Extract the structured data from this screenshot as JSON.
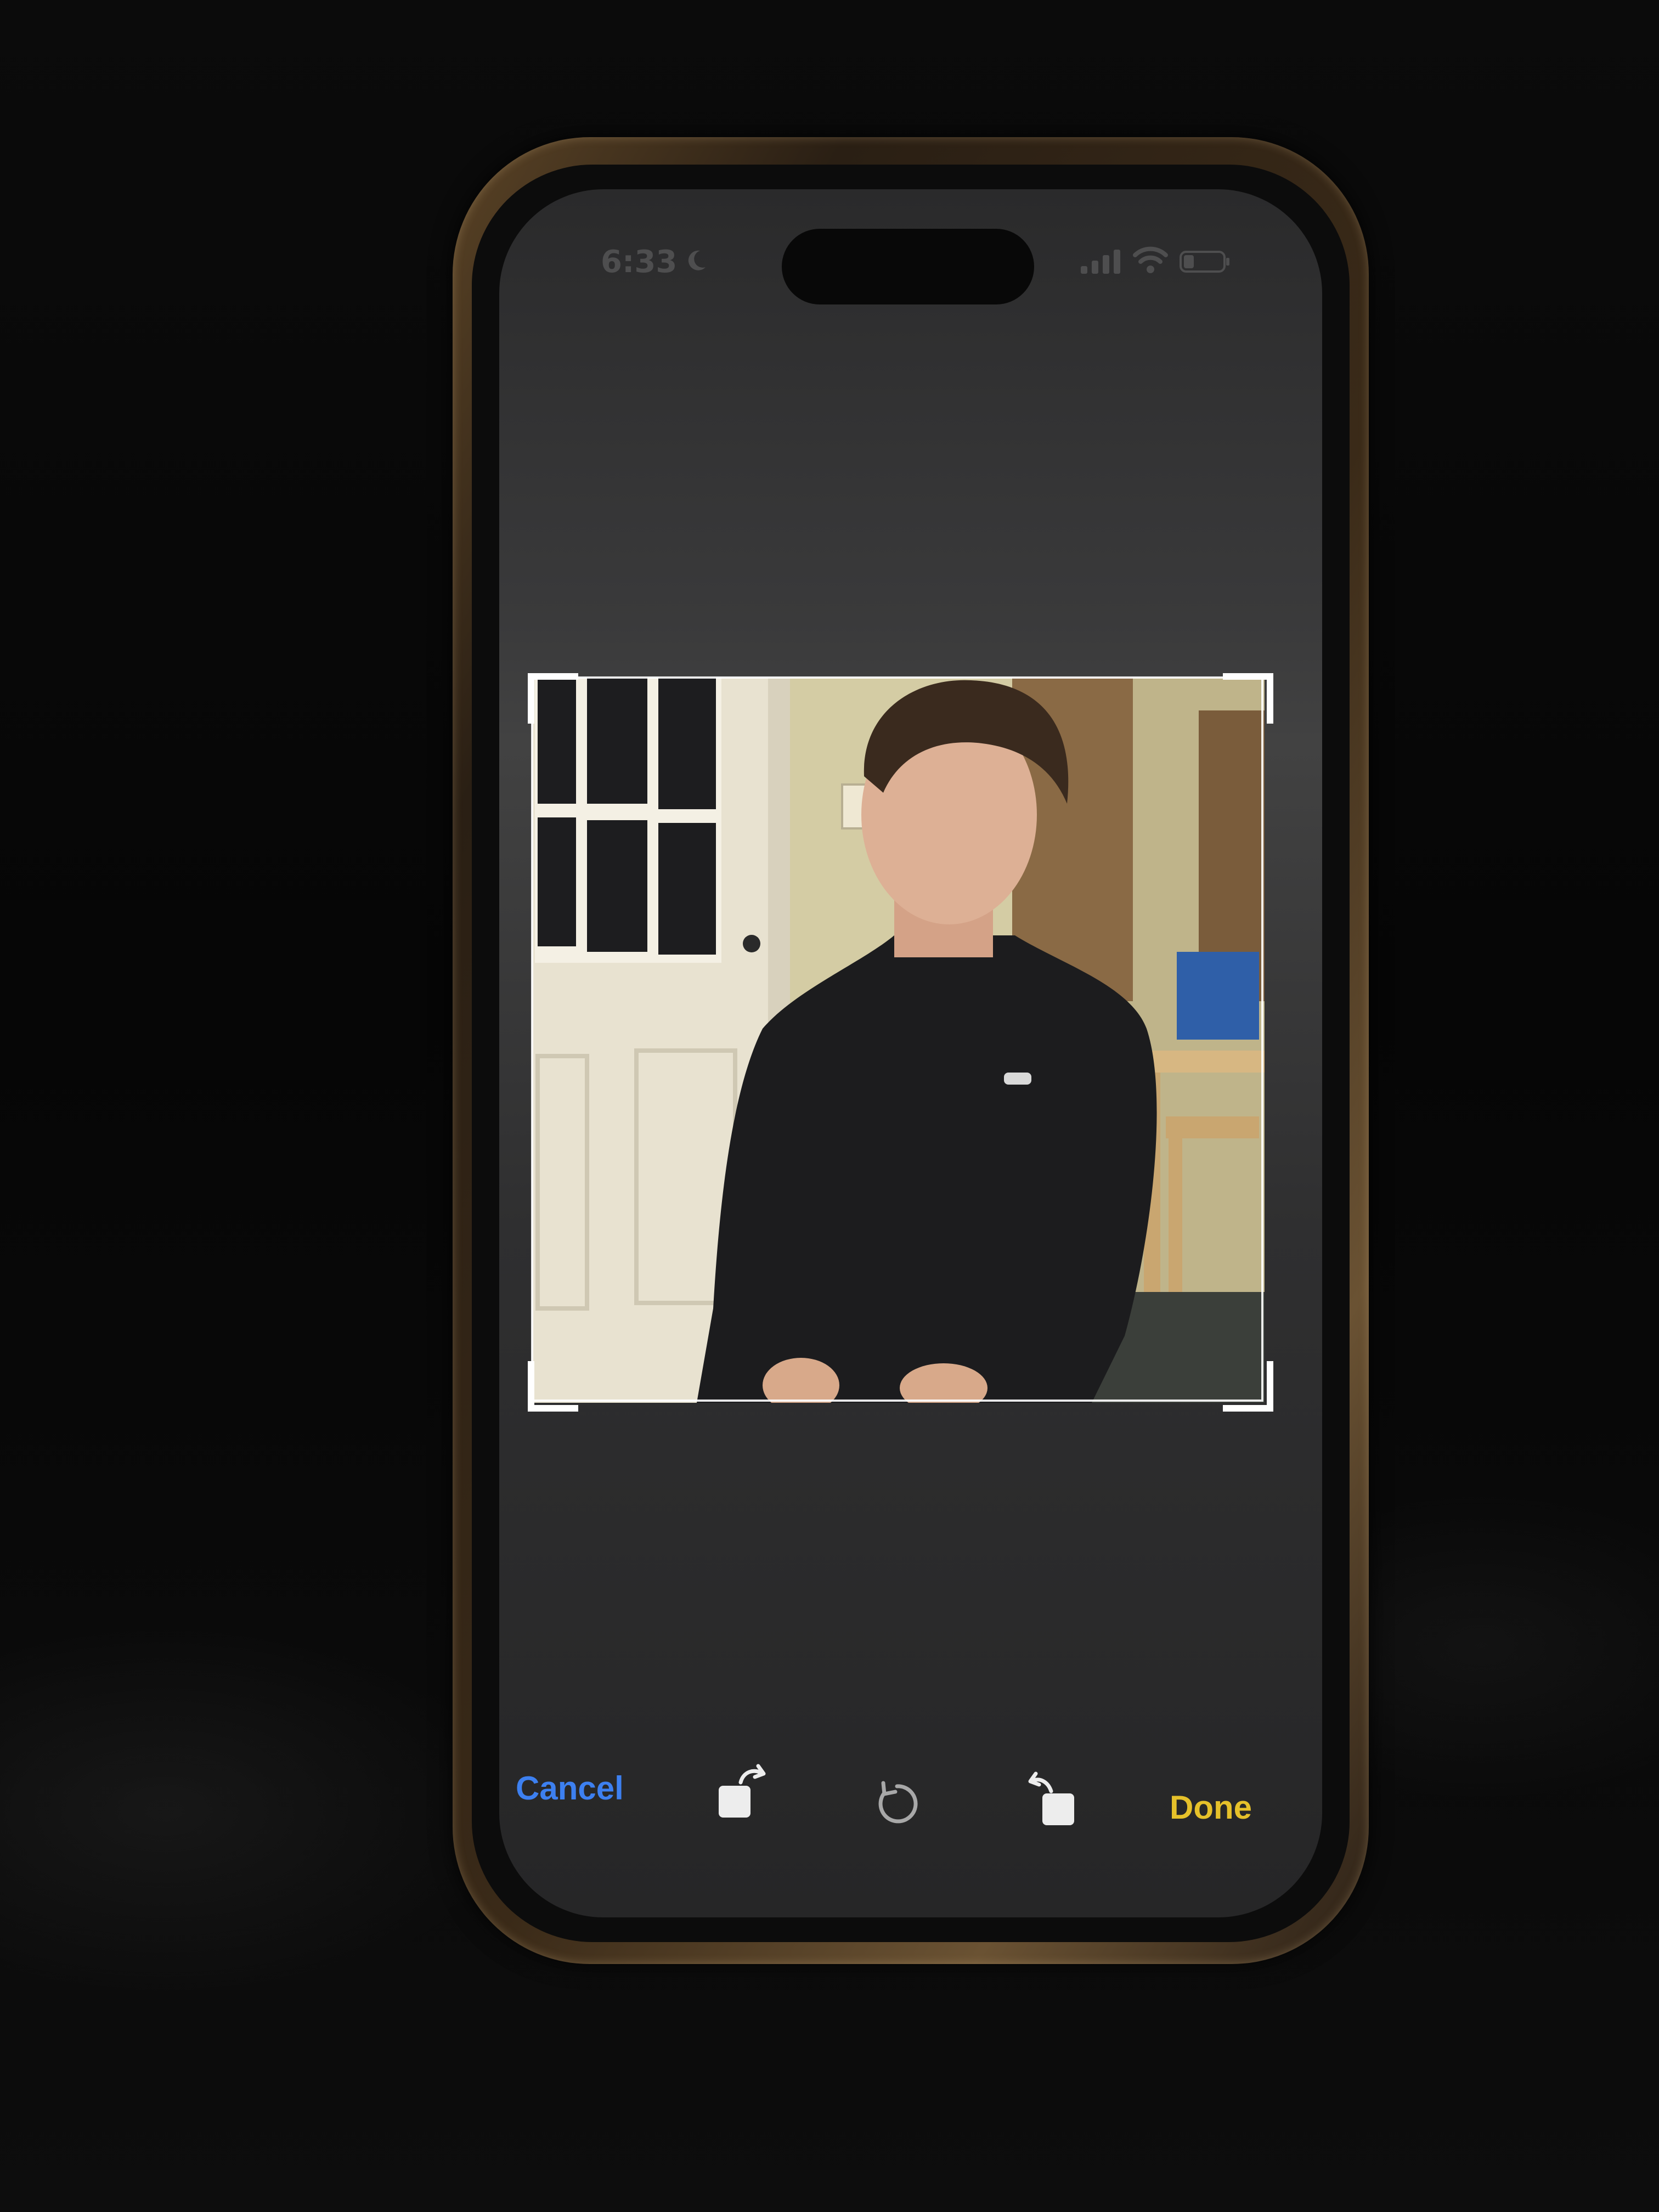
{
  "status_bar": {
    "time": "6:33",
    "focus_icon": "moon-icon",
    "signal_icon": "cellular-signal-icon",
    "wifi_icon": "wifi-icon",
    "battery_icon": "battery-icon"
  },
  "editor": {
    "mode": "crop",
    "photo_icon": "photo-subject"
  },
  "toolbar": {
    "cancel_label": "Cancel",
    "done_label": "Done",
    "tools": [
      {
        "name": "rotate-left-icon"
      },
      {
        "name": "reset-rotation-icon"
      },
      {
        "name": "rotate-right-icon"
      }
    ]
  },
  "colors": {
    "cancel": "#3d80f0",
    "done": "#e6c12a"
  }
}
